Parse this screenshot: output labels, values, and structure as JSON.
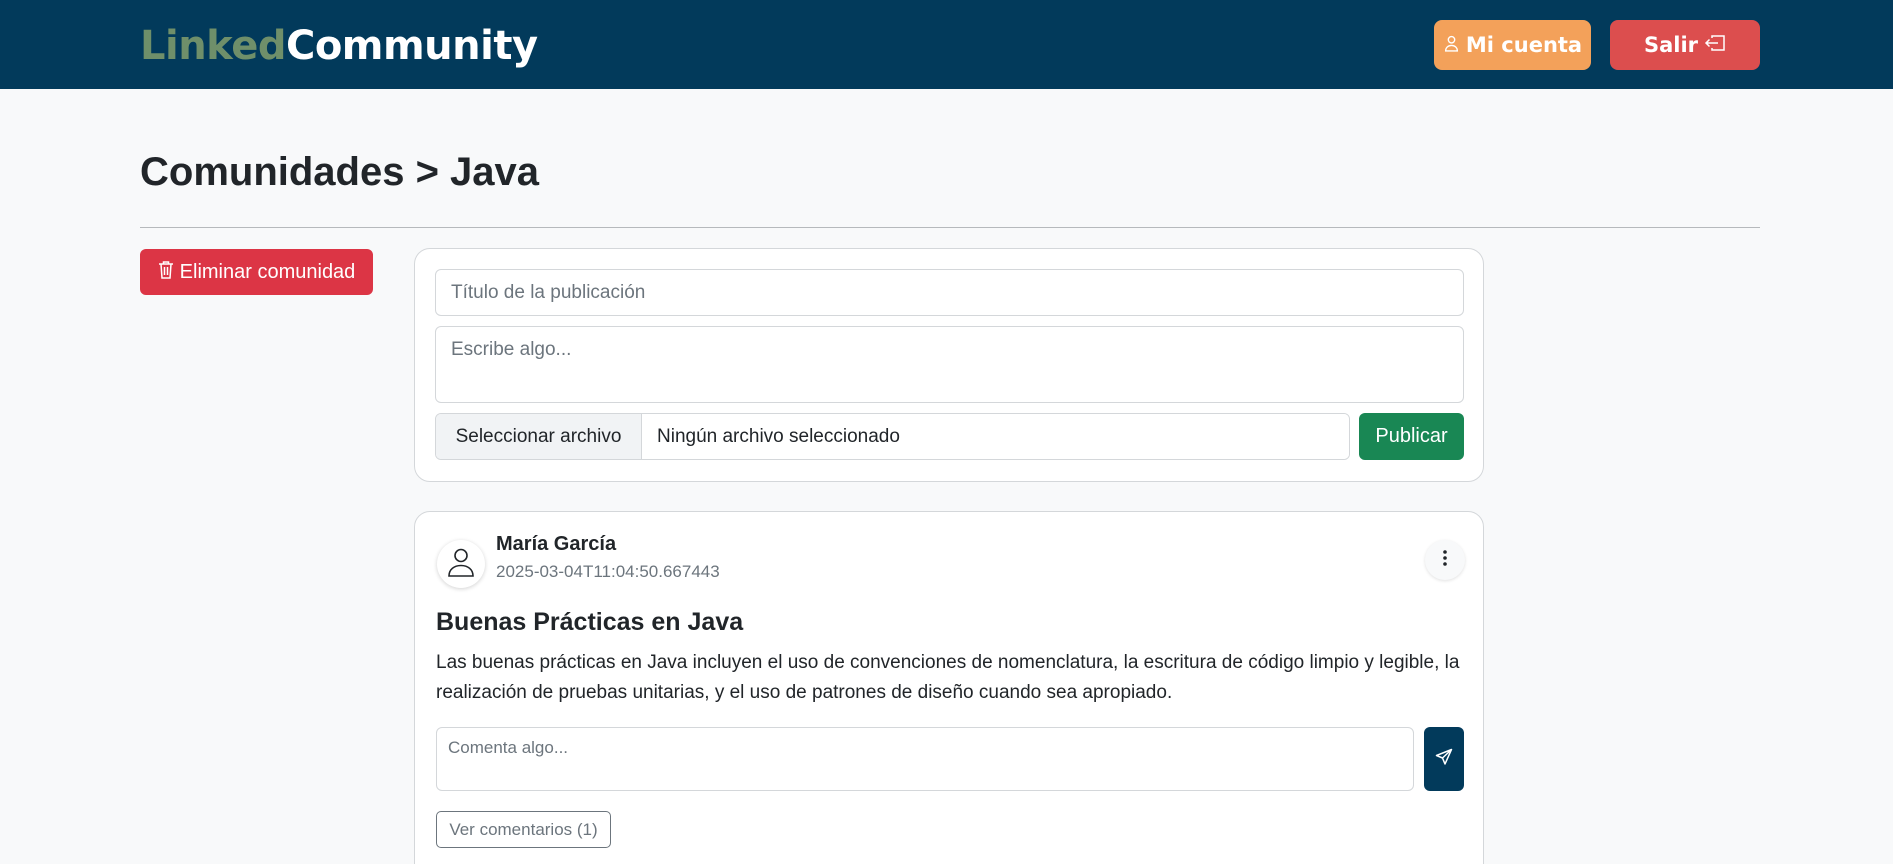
{
  "navbar": {
    "brand_part1": "Linked",
    "brand_part2": "Community",
    "account_label": "Mi cuenta",
    "account_icon": "person-icon",
    "logout_label": "Salir",
    "logout_icon": "box-arrow-left-icon",
    "background_color": "#023a5b",
    "account_color": "#f3a15a",
    "logout_color": "#dc4e4e"
  },
  "page": {
    "title": "Comunidades > Java"
  },
  "actions": {
    "delete_label": "Eliminar comunidad",
    "delete_icon": "trash-icon",
    "delete_color": "#dc3545"
  },
  "composer": {
    "title_placeholder": "Título de la publicación",
    "body_placeholder": "Escribe algo...",
    "file_button_label": "Seleccionar archivo",
    "file_status": "Ningún archivo seleccionado",
    "publish_label": "Publicar",
    "publish_color": "#198754"
  },
  "posts": [
    {
      "author": "María García",
      "timestamp": "2025-03-04T11:04:50.667443",
      "title": "Buenas Prácticas en Java",
      "body": "Las buenas prácticas en Java incluyen el uso de convenciones de nomenclatura, la escritura de código limpio y legible, la realización de pruebas unitarias, y el uso de patrones de diseño cuando sea apropiado.",
      "comment_placeholder": "Comenta algo...",
      "view_comments_label": "Ver comentarios (1)",
      "avatar_icon": "person-icon",
      "menu_icon": "three-dots-vertical-icon",
      "send_icon": "send-icon"
    }
  ]
}
